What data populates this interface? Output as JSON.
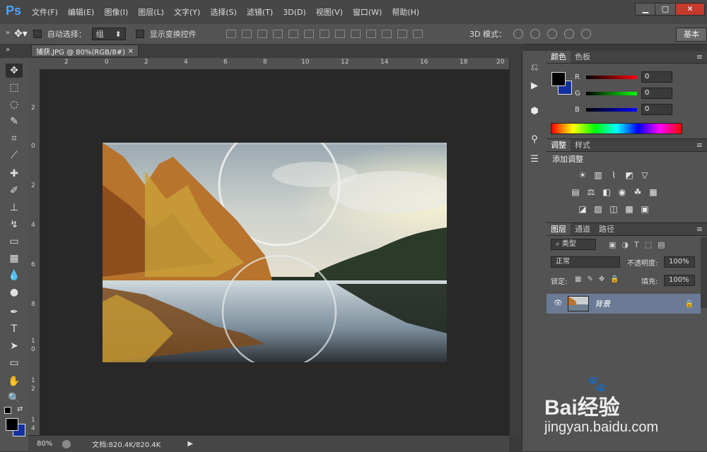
{
  "app": {
    "logo": "Ps"
  },
  "menu": [
    "文件(F)",
    "编辑(E)",
    "图像(I)",
    "图层(L)",
    "文字(Y)",
    "选择(S)",
    "滤镜(T)",
    "3D(D)",
    "视图(V)",
    "窗口(W)",
    "帮助(H)"
  ],
  "window_controls": {
    "minimize": "▁",
    "maximize": "□",
    "close": "✕"
  },
  "options": {
    "auto_select_label": "自动选择：",
    "auto_select_value": "组",
    "show_transform_label": "显示变换控件",
    "mode3d_label": "3D 模式：",
    "workspace_label": "基本"
  },
  "document": {
    "tab_title": "捕获.JPG @ 80%(RGB/8#)",
    "tab_close": "×",
    "zoom": "80%",
    "doc_info": "文档:820.4K/820.4K"
  },
  "ruler": {
    "h_ticks": [
      "2",
      "0",
      "2",
      "4",
      "6",
      "8",
      "10",
      "12",
      "14",
      "16",
      "18",
      "20"
    ],
    "v_ticks": [
      "2",
      "0",
      "2",
      "4",
      "6",
      "8",
      "1",
      "0",
      "1",
      "2",
      "1",
      "4"
    ]
  },
  "color_panel": {
    "tabs": [
      "颜色",
      "色板"
    ],
    "r_label": "R",
    "g_label": "G",
    "b_label": "B",
    "r_value": "0",
    "g_value": "0",
    "b_value": "0"
  },
  "adjust_panel": {
    "tabs": [
      "调整",
      "样式"
    ],
    "add_label": "添加调整"
  },
  "layers_panel": {
    "tabs": [
      "图层",
      "通道",
      "路径"
    ],
    "filter_label": "类型",
    "blend_mode": "正常",
    "opacity_label": "不透明度:",
    "opacity_value": "100%",
    "lock_label": "锁定:",
    "fill_label": "填充:",
    "fill_value": "100%",
    "layer_name": "背景"
  },
  "watermark": {
    "brand": "Bai经验",
    "url": "jingyan.baidu.com"
  },
  "colors": {
    "menubar": "#474747",
    "panel": "#535353",
    "canvas": "#282828",
    "layer_selected": "#6b7b95",
    "accent": "#4aa3ff"
  }
}
